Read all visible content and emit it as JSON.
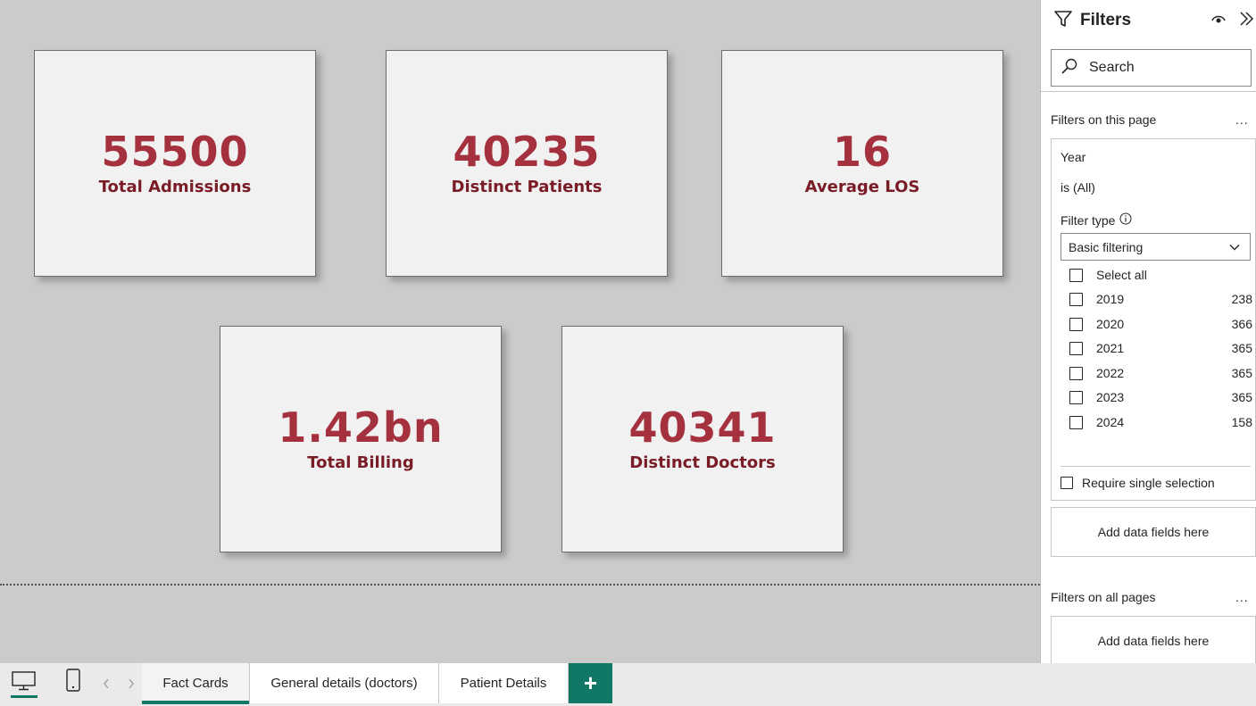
{
  "cards": [
    {
      "value": "55500",
      "label": "Total Admissions"
    },
    {
      "value": "40235",
      "label": "Distinct Patients"
    },
    {
      "value": "16",
      "label": "Average LOS"
    },
    {
      "value": "1.42bn",
      "label": "Total Billing"
    },
    {
      "value": "40341",
      "label": "Distinct Doctors"
    }
  ],
  "filters_pane": {
    "title": "Filters",
    "search_placeholder": "Search",
    "filters_on_page_label": "Filters on this page",
    "more_label": "...",
    "year_filter": {
      "field": "Year",
      "state": "is (All)",
      "filter_type_label": "Filter type",
      "filter_type_value": "Basic filtering",
      "select_all_label": "Select all",
      "options": [
        {
          "label": "2019",
          "count": "238"
        },
        {
          "label": "2020",
          "count": "366"
        },
        {
          "label": "2021",
          "count": "365"
        },
        {
          "label": "2022",
          "count": "365"
        },
        {
          "label": "2023",
          "count": "365"
        },
        {
          "label": "2024",
          "count": "158"
        }
      ],
      "require_single_label": "Require single selection"
    },
    "add_fields_label": "Add data fields here",
    "filters_all_pages_label": "Filters on all pages",
    "add_fields_all_label": "Add data fields here"
  },
  "tabs": [
    {
      "label": "Fact Cards",
      "active": true
    },
    {
      "label": "General details (doctors)",
      "active": false
    },
    {
      "label": "Patient Details",
      "active": false
    }
  ],
  "add_tab_label": "+",
  "colors": {
    "accent": "#117865",
    "card_value": "#a4313d",
    "card_label": "#7a1c26"
  }
}
